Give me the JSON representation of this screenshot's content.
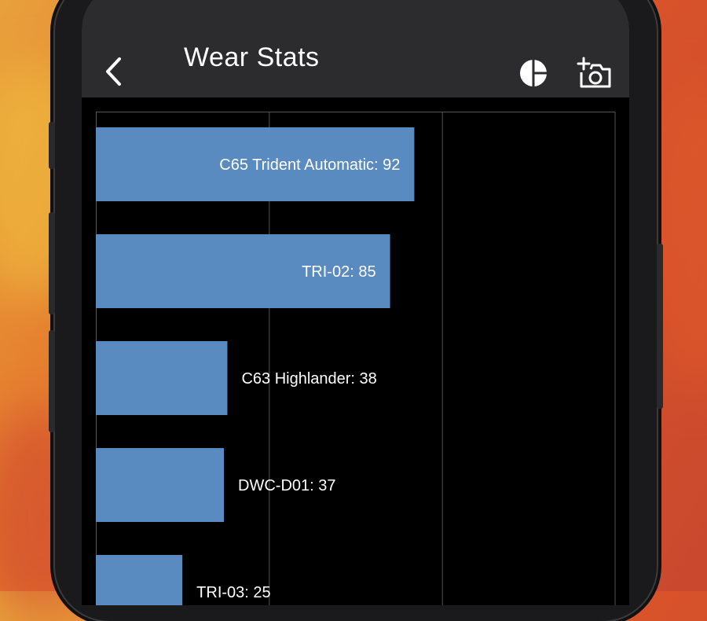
{
  "header": {
    "title": "Wear Stats",
    "back_icon": "chevron-left-icon",
    "chart_icon": "pie-chart-icon",
    "camera_icon": "add-photo-icon"
  },
  "colors": {
    "bar": "#5a8bc0",
    "nav_bg": "#2c2c2e",
    "screen_bg": "#000000",
    "gridline": "#555555"
  },
  "chart_data": {
    "type": "bar",
    "orientation": "horizontal",
    "grid": true,
    "xlim": [
      0,
      150
    ],
    "categories": [
      "C65 Trident Automatic",
      "TRI-02",
      "C63 Highlander",
      "DWC-D01",
      "TRI-03"
    ],
    "values": [
      92,
      85,
      38,
      37,
      25
    ],
    "data_labels": [
      "C65 Trident Automatic: 92",
      "TRI-02: 85",
      "C63 Highlander: 38",
      "DWC-D01: 37",
      "TRI-03: 25"
    ]
  }
}
